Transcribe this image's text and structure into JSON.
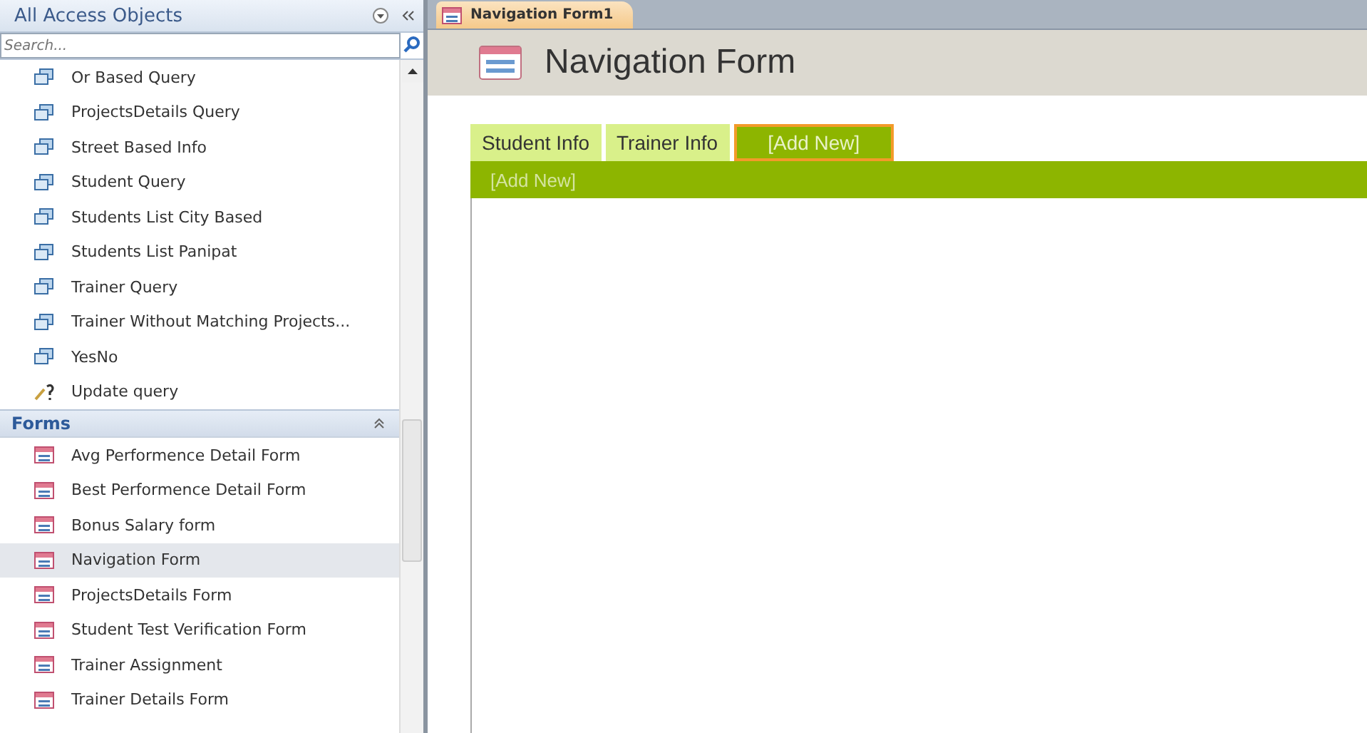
{
  "nav_pane": {
    "title": "All Access Objects",
    "search": {
      "placeholder": "Search..."
    },
    "groups": [
      {
        "items": [
          {
            "label": "Or Based Query",
            "kind": "select",
            "selected": false
          },
          {
            "label": "ProjectsDetails Query",
            "kind": "select",
            "selected": false
          },
          {
            "label": "Street Based Info",
            "kind": "select",
            "selected": false
          },
          {
            "label": "Student Query",
            "kind": "select",
            "selected": false
          },
          {
            "label": "Students List City Based",
            "kind": "select",
            "selected": false
          },
          {
            "label": "Students List Panipat",
            "kind": "select",
            "selected": false
          },
          {
            "label": "Trainer Query",
            "kind": "select",
            "selected": false
          },
          {
            "label": "Trainer Without Matching Projects...",
            "kind": "select",
            "selected": false
          },
          {
            "label": "YesNo",
            "kind": "select",
            "selected": false
          },
          {
            "label": "Update query",
            "kind": "update",
            "selected": false
          }
        ]
      },
      {
        "title": "Forms",
        "expanded": true,
        "items": [
          {
            "label": "Avg Performence Detail Form",
            "kind": "form",
            "selected": false
          },
          {
            "label": "Best Performence Detail Form",
            "kind": "form",
            "selected": false
          },
          {
            "label": "Bonus Salary form",
            "kind": "form",
            "selected": false
          },
          {
            "label": "Navigation Form",
            "kind": "form",
            "selected": true
          },
          {
            "label": "ProjectsDetails Form",
            "kind": "form",
            "selected": false
          },
          {
            "label": "Student Test Verification Form",
            "kind": "form",
            "selected": false
          },
          {
            "label": "Trainer Assignment",
            "kind": "form",
            "selected": false
          },
          {
            "label": "Trainer Details Form",
            "kind": "form",
            "selected": false
          }
        ]
      }
    ]
  },
  "document_tab": {
    "label": "Navigation Form1"
  },
  "form": {
    "title": "Navigation Form",
    "tabs": [
      {
        "label": "Student Info",
        "selected": false
      },
      {
        "label": "Trainer Info",
        "selected": false
      },
      {
        "label": "[Add New]",
        "selected": true
      }
    ],
    "subtab_placeholder": "[Add New]"
  }
}
